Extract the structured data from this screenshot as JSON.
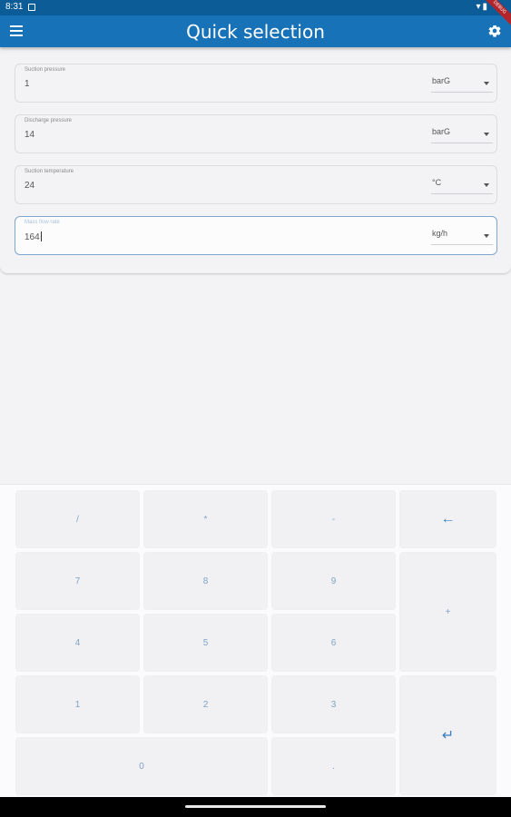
{
  "status_bar": {
    "time": "8:31",
    "debug_banner": "DEBUG"
  },
  "app_bar": {
    "title": "Quick selection"
  },
  "fields": [
    {
      "label": "Suction pressure",
      "value": "1",
      "unit": "barG"
    },
    {
      "label": "Discharge pressure",
      "value": "14",
      "unit": "barG"
    },
    {
      "label": "Suction temperature",
      "value": "24",
      "unit": "°C"
    },
    {
      "label": "Mass flow rate",
      "value": "164",
      "unit": "kg/h"
    }
  ],
  "keypad": {
    "divide": "/",
    "multiply": "*",
    "minus": "-",
    "backspace": "←",
    "seven": "7",
    "eight": "8",
    "nine": "9",
    "plus": "+",
    "four": "4",
    "five": "5",
    "six": "6",
    "one": "1",
    "two": "2",
    "three": "3",
    "enter": "↵",
    "zero": "0",
    "decimal": "."
  },
  "colors": {
    "status_bar": "#0c5c98",
    "app_bar": "#1772b8",
    "accent": "#3d7fc1",
    "background": "#f3f3f5"
  }
}
